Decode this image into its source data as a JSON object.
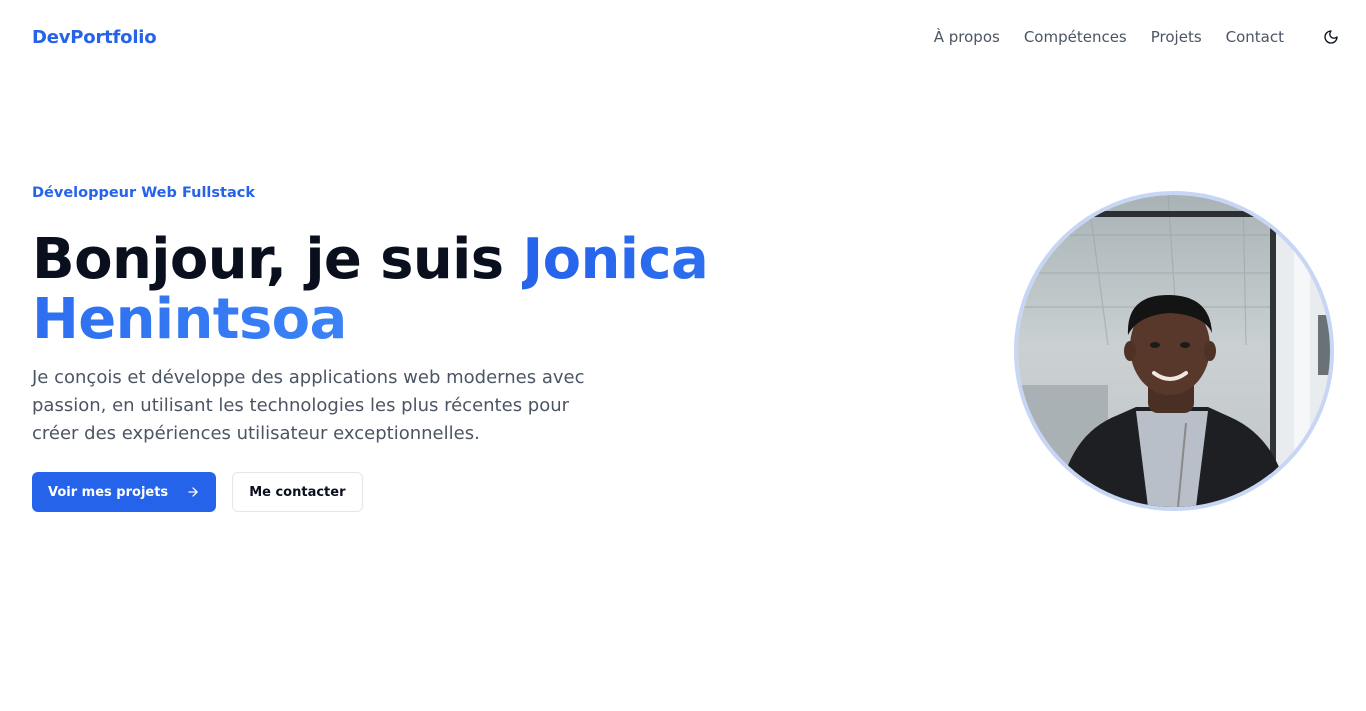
{
  "nav": {
    "logo": "DevPortfolio",
    "links": [
      "À propos",
      "Compétences",
      "Projets",
      "Contact"
    ],
    "theme_icon": "moon-icon"
  },
  "hero": {
    "eyebrow": "Développeur Web Fullstack",
    "greeting": "Bonjour, je suis",
    "name": "Jonica Henintsoa",
    "description": "Je conçois et développe des applications web modernes avec passion, en utilisant les technologies les plus récentes pour créer des expériences utilisateur exceptionnelles.",
    "primary_button": "Voir mes projets",
    "primary_icon": "arrow-right-icon",
    "secondary_button": "Me contacter"
  },
  "colors": {
    "accent": "#2563eb",
    "heading": "#0a0f1e",
    "body_text": "#4b5563"
  }
}
